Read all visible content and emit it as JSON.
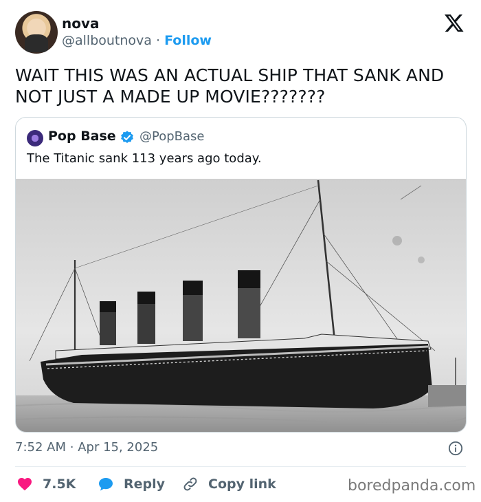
{
  "author": {
    "name": "nova",
    "handle": "@allboutnova",
    "separator": "·",
    "follow_label": "Follow"
  },
  "tweet": {
    "text": "WAIT THIS WAS AN ACTUAL SHIP THAT SANK AND NOT JUST A MADE UP MOVIE???????"
  },
  "quoted": {
    "name": "Pop Base",
    "handle": "@PopBase",
    "text": "The Titanic sank 113 years ago today."
  },
  "meta": {
    "time": "7:52 AM",
    "separator": "·",
    "date": "Apr 15, 2025"
  },
  "actions": {
    "likes": "7.5K",
    "reply_label": "Reply",
    "copy_label": "Copy link"
  },
  "watermark": "boredpanda.com",
  "icons": {
    "x_logo": "x-logo-icon",
    "verified": "verified-badge-icon",
    "info": "info-icon",
    "like": "heart-icon",
    "reply": "reply-bubble-icon",
    "copy": "link-icon"
  },
  "colors": {
    "accent": "#1d9bf0",
    "like": "#f91880",
    "text": "#0f1419",
    "muted": "#536471"
  }
}
